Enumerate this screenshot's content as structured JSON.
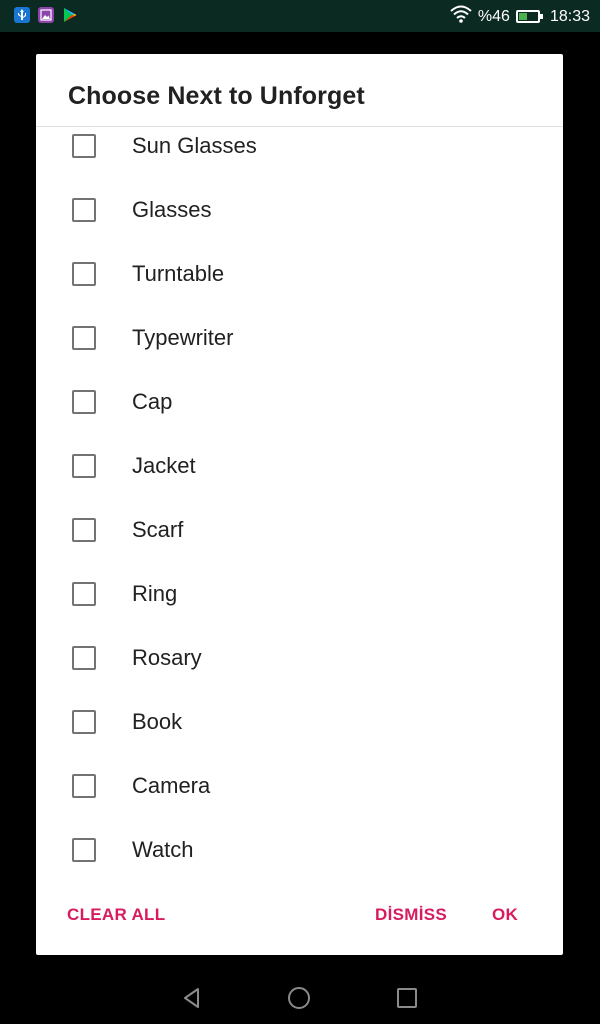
{
  "status_bar": {
    "notifications": [
      "usb-icon",
      "image-icon",
      "play-store-icon"
    ],
    "battery_percent": "%46",
    "battery_level": 0.46,
    "time": "18:33"
  },
  "dialog": {
    "title": "Choose Next to Unforget",
    "items": [
      {
        "label": "Sun Glasses",
        "checked": false
      },
      {
        "label": "Glasses",
        "checked": false
      },
      {
        "label": "Turntable",
        "checked": false
      },
      {
        "label": "Typewriter",
        "checked": false
      },
      {
        "label": "Cap",
        "checked": false
      },
      {
        "label": "Jacket",
        "checked": false
      },
      {
        "label": "Scarf",
        "checked": false
      },
      {
        "label": "Ring",
        "checked": false
      },
      {
        "label": "Rosary",
        "checked": false
      },
      {
        "label": "Book",
        "checked": false
      },
      {
        "label": "Camera",
        "checked": false
      },
      {
        "label": "Watch",
        "checked": false
      }
    ],
    "actions": {
      "clear_all": "CLEAR ALL",
      "dismiss": "DİSMİSS",
      "ok": "OK"
    }
  },
  "colors": {
    "accent": "#d81b60",
    "status_bar": "#0b2a22"
  },
  "nav_bar": {
    "buttons": [
      "back-icon",
      "home-icon",
      "recents-icon"
    ]
  }
}
